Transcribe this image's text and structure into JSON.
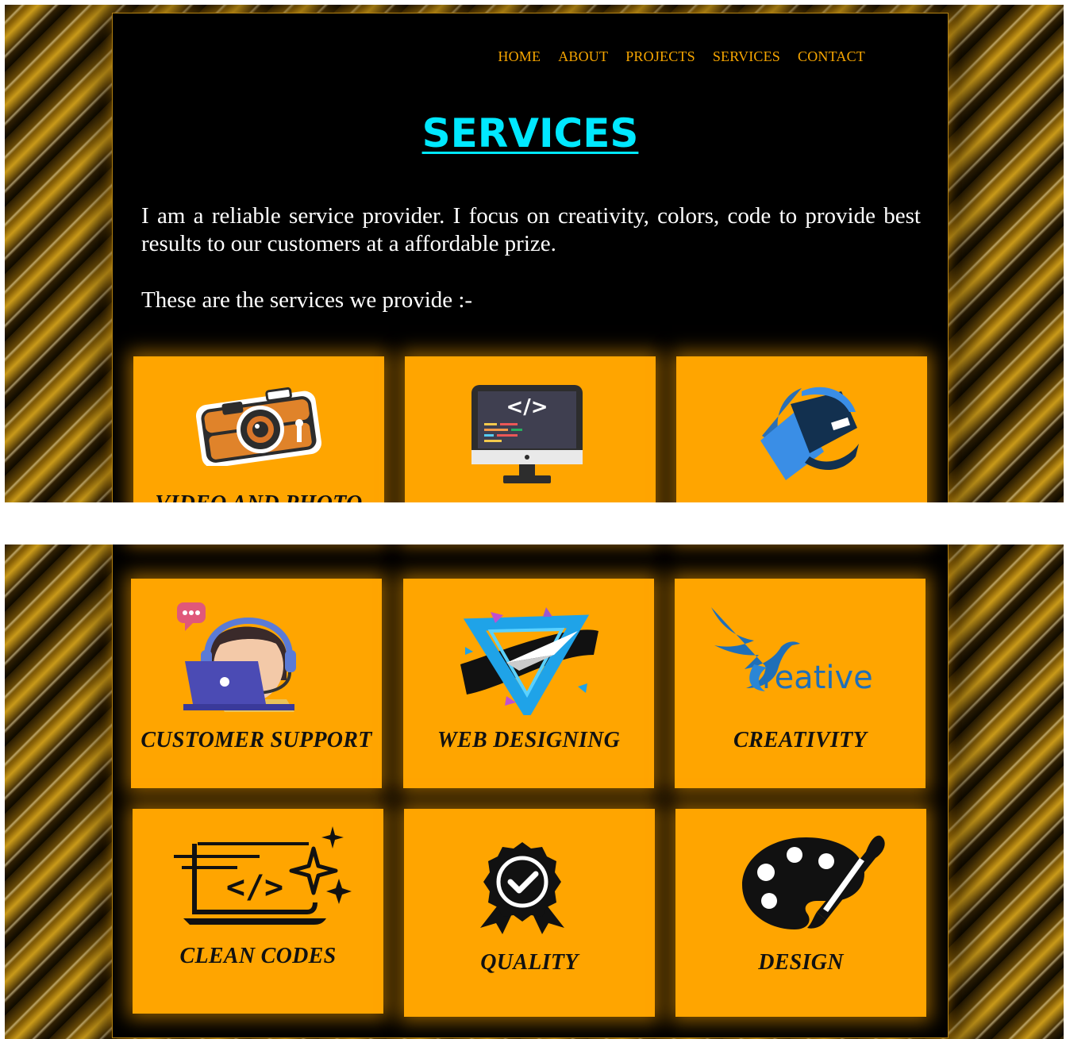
{
  "nav": {
    "items": [
      "HOME",
      "ABOUT",
      "PROJECTS",
      "SERVICES",
      "CONTACT"
    ]
  },
  "page": {
    "title": "SERVICES",
    "intro": "I am a reliable service provider. I focus on creativity, colors, code to provide best results to our customers at a affordable prize.",
    "list_intro": "These are the services we provide :-"
  },
  "services": [
    {
      "label": "VIDEO AND PHOTO",
      "icon": "camera-icon"
    },
    {
      "label": "",
      "icon": "code-monitor-icon"
    },
    {
      "label": "",
      "icon": "wallet-icon"
    },
    {
      "label": "CUSTOMER SUPPORT",
      "icon": "support-agent-icon"
    },
    {
      "label": "WEB DESIGNING",
      "icon": "web-design-triangle-icon"
    },
    {
      "label": "CREATIVITY",
      "icon": "creative-bird-logo"
    },
    {
      "label": "CLEAN CODES",
      "icon": "clean-code-sparkle-icon"
    },
    {
      "label": "QUALITY",
      "icon": "quality-badge-icon"
    },
    {
      "label": "DESIGN",
      "icon": "palette-icon"
    }
  ],
  "creative_logo_text": "reative",
  "colors": {
    "accent": "#ffa500",
    "title": "#00e8ff",
    "nav": "#f7a600",
    "panel": "#000000"
  }
}
